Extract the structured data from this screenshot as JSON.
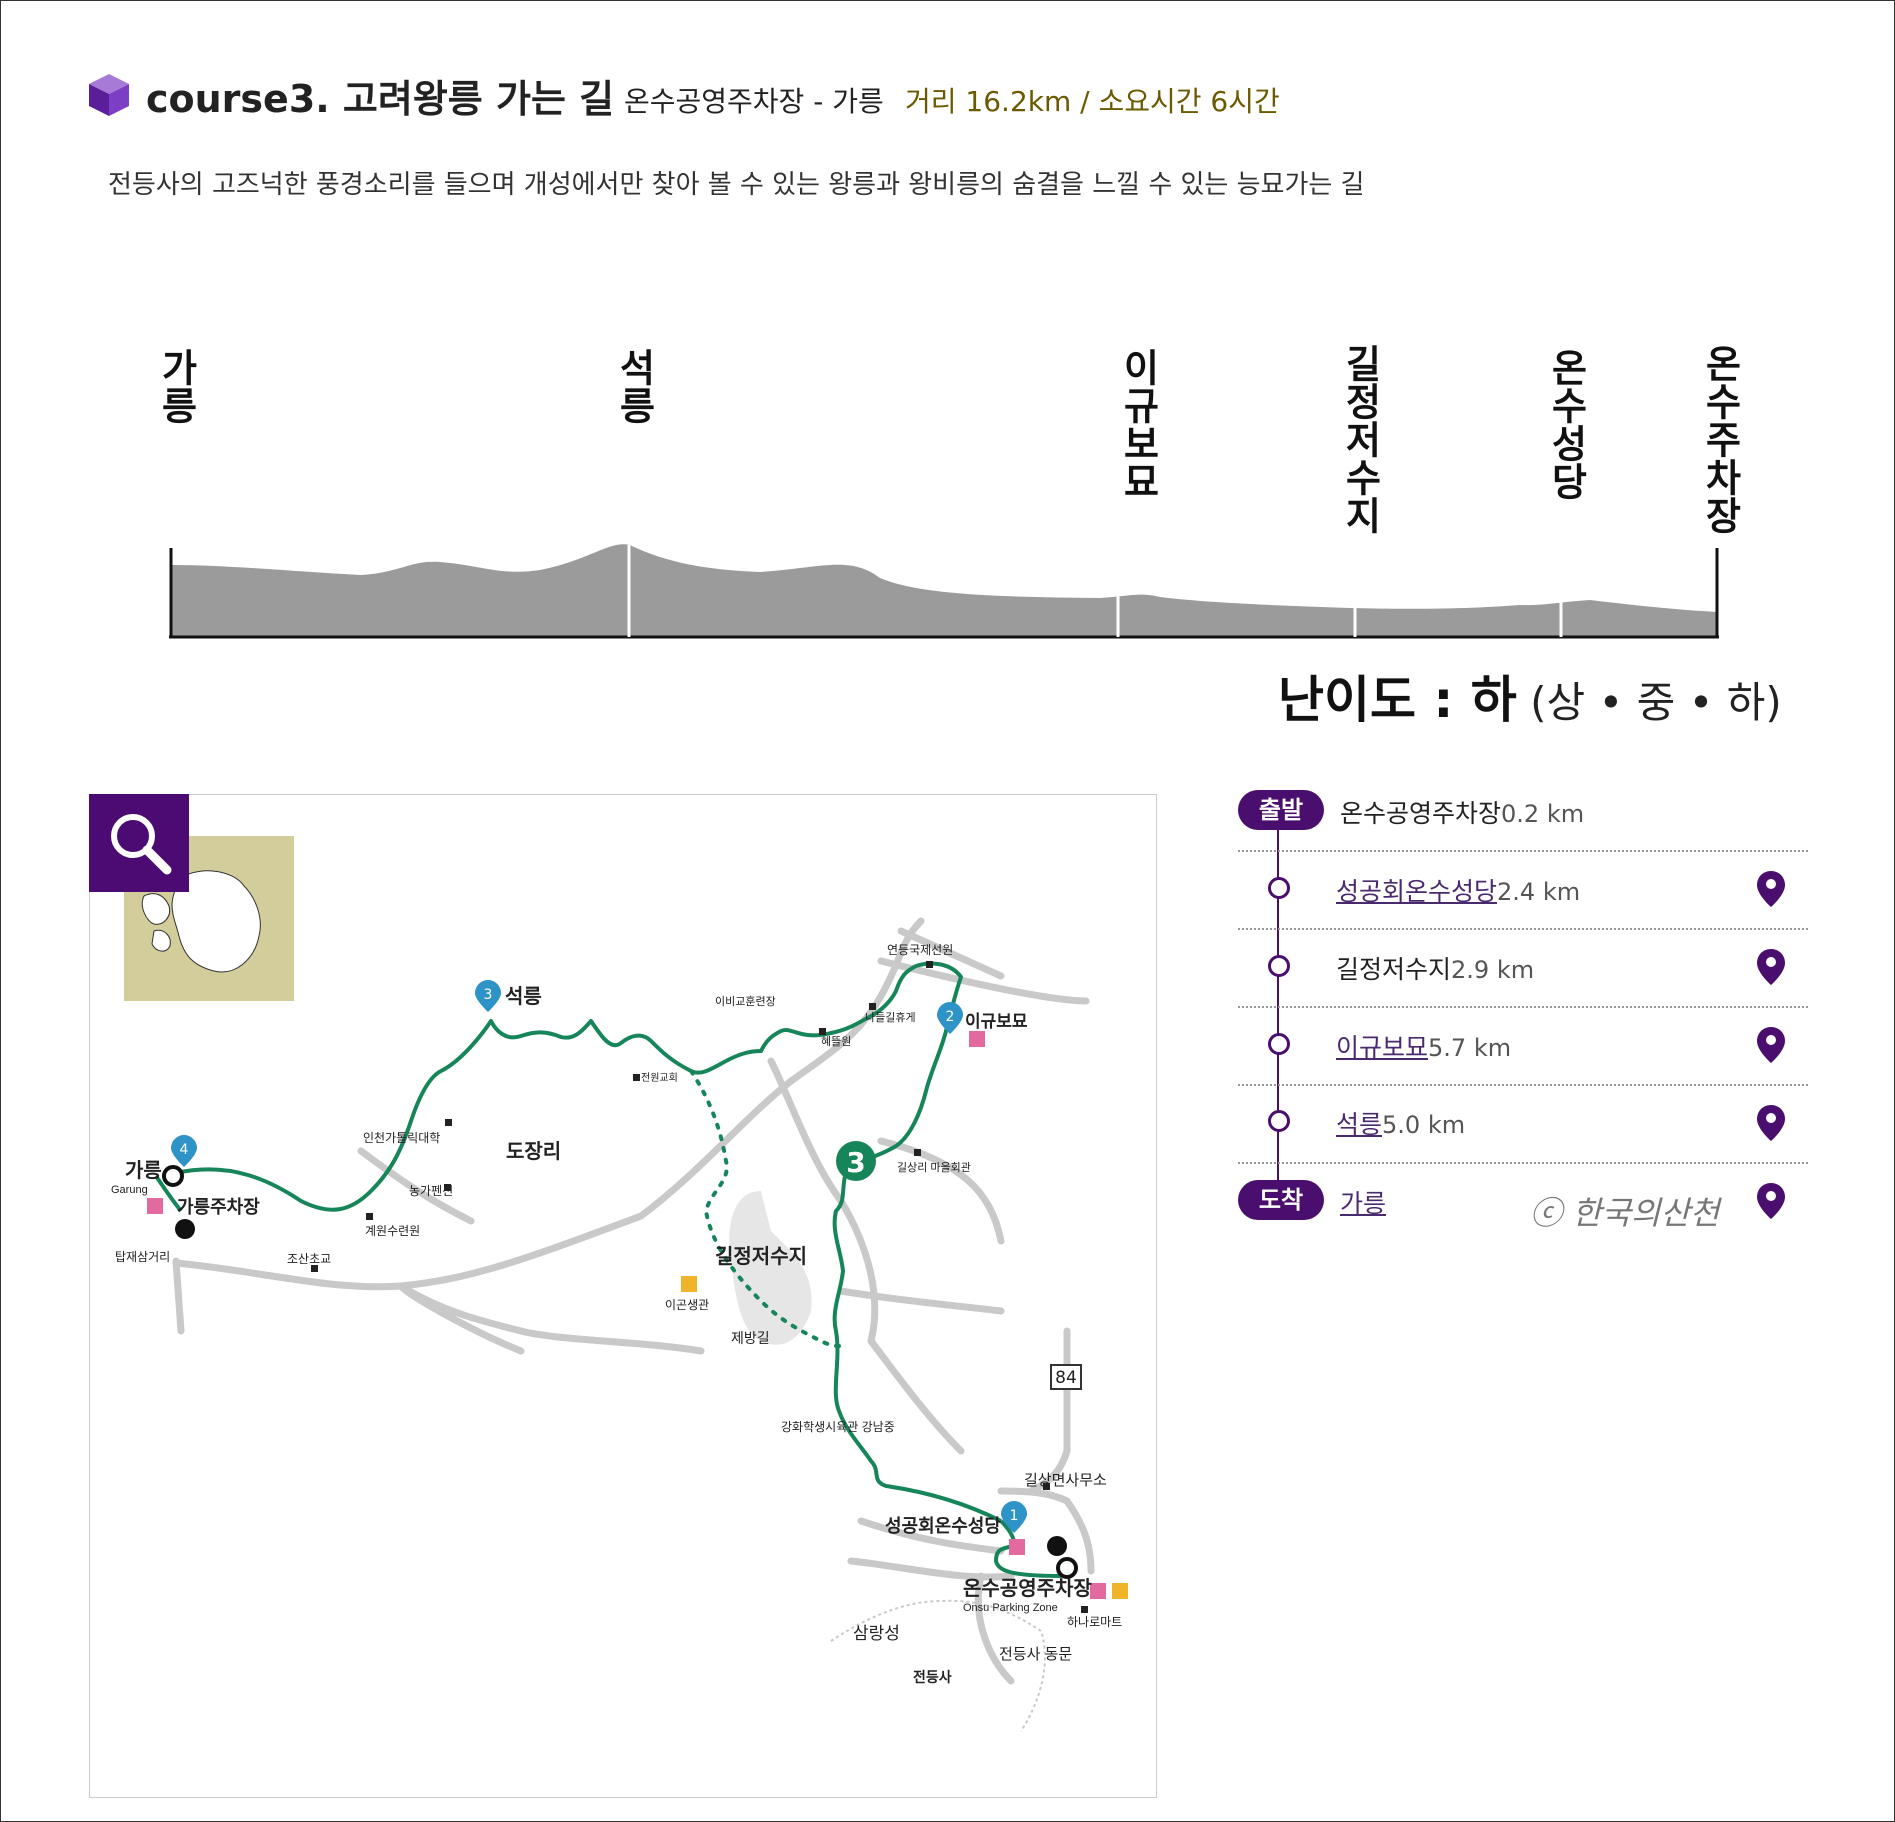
{
  "header": {
    "title": "course3. 고려왕릉 가는 길",
    "route": "온수공영주차장 - 가릉",
    "meta": "거리 16.2km / 소요시간 6시간",
    "description": "전등사의 고즈넉한 풍경소리를 들으며 개성에서만 찾아 볼 수 있는 왕릉과 왕비릉의 숨결을 느낄 수 있는 능묘가는 길"
  },
  "profile": {
    "labels": [
      "가릉",
      "석릉",
      "이규보묘",
      "길정저수지",
      "온수성당",
      "온수주차장"
    ],
    "difficulty_label": "난이도 : 하",
    "difficulty_scale": " (상 • 중 • 하)",
    "fill_color": "#9b9b9b"
  },
  "map": {
    "labels": {
      "garung": "가릉",
      "garung_en": "Garung",
      "garung_parking": "가릉주차장",
      "seokreung": "석릉",
      "igyubo": "이규보묘",
      "dojangri": "도장리",
      "giljeong": "길정저수지",
      "onsu_parking": "온수공영주차장",
      "onsu_parking_en": "Onsu Parking Zone",
      "church": "성공회온수성당",
      "office": "길상면사무소",
      "samrangseong": "삼랑성",
      "jeondeungsa": "전등사",
      "jeondeungsa_east": "전등사 동문",
      "univ": "인천가톨릭대학",
      "road": "84",
      "s1": "연등국제선원",
      "s2": "이비교훈련장",
      "s3": "나들길휴게",
      "s4": "혜뜰원",
      "s5": "길상리 마을회관",
      "s6": "농가펜션",
      "s7": "계원수련원",
      "s8": "조산초교",
      "s9": "탑재삼거리",
      "s10": "이곤생관",
      "s11": "제방길",
      "s12": "강화학생시육관 강남중",
      "s13": "하나로마트",
      "s14": "전원교회"
    },
    "markers": [
      "1",
      "2",
      "3",
      "4"
    ],
    "route_color": "#16855a"
  },
  "itinerary": {
    "start_label": "출발",
    "end_label": "도착",
    "stops": [
      {
        "name": "온수공영주차장",
        "dist": "0.2 km",
        "link": false
      },
      {
        "name": "성공회온수성당",
        "dist": "2.4 km",
        "link": true
      },
      {
        "name": "길정저수지",
        "dist": "2.9 km",
        "link": false
      },
      {
        "name": "이규보묘",
        "dist": "5.7 km",
        "link": true
      },
      {
        "name": "석릉",
        "dist": "5.0 km",
        "link": true
      },
      {
        "name": "가릉",
        "dist": "",
        "link": true
      }
    ],
    "accent": "#4a0f6e"
  },
  "watermark": "ⓒ 한국의산천"
}
